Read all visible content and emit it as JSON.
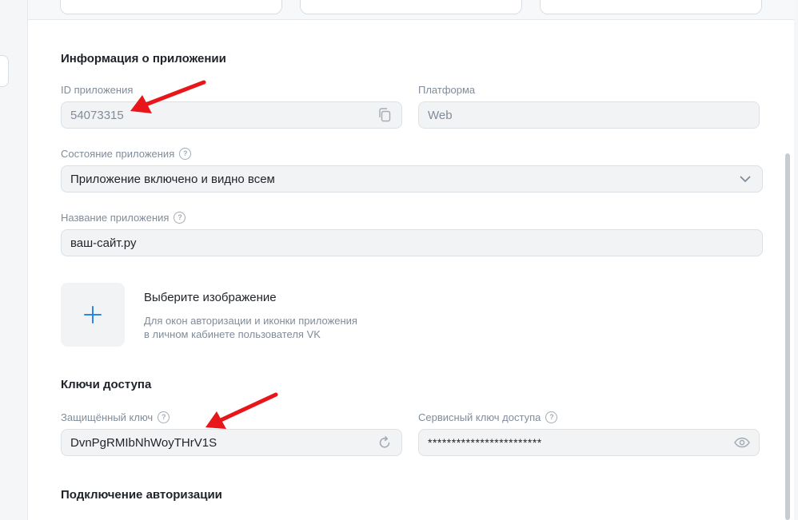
{
  "app_info": {
    "section_title": "Информация о приложении",
    "app_id": {
      "label": "ID приложения",
      "value": "54073315",
      "copy_icon": "copy-icon"
    },
    "platform": {
      "label": "Платформа",
      "value": "Web"
    },
    "state": {
      "label": "Состояние приложения",
      "value": "Приложение включено и видно всем",
      "icon": "chevron-down-icon"
    },
    "name": {
      "label": "Название приложения",
      "value": "ваш-сайт.ру"
    },
    "image": {
      "title": "Выберите изображение",
      "description_line1": "Для окон авторизации и иконки приложения",
      "description_line2": "в личном кабинете пользователя VK"
    }
  },
  "access_keys": {
    "section_title": "Ключи доступа",
    "protected_key": {
      "label": "Защищённый ключ",
      "value": "DvnPgRMIbNhWoyTHrV1S",
      "icon": "refresh-icon"
    },
    "service_key": {
      "label": "Сервисный ключ доступа",
      "value": "************************",
      "icon": "eye-icon"
    }
  },
  "auth": {
    "section_title": "Подключение авторизации"
  },
  "colors": {
    "annotation_arrow": "#e8161b",
    "accent": "#2688eb"
  }
}
